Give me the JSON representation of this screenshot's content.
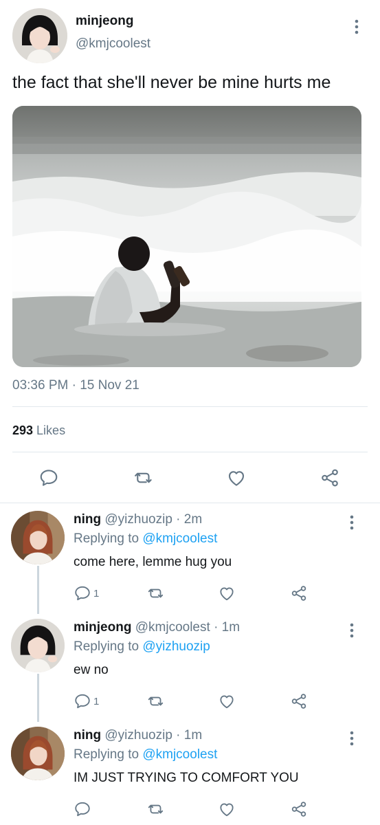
{
  "tweet": {
    "author_name": "minjeong",
    "author_handle": "@kmjcoolest",
    "text": "the fact that she'll never be mine hurts me",
    "timestamp": "03:36 PM · 15 Nov 21",
    "likes_count": "293",
    "likes_label": "Likes"
  },
  "actions": [
    "reply-icon",
    "retweet-icon",
    "like-icon",
    "share-icon"
  ],
  "colors": {
    "accent": "#1da1f2",
    "secondary": "#657786",
    "divider": "#e1e8ed"
  },
  "replies": [
    {
      "name": "ning",
      "handle": "@yizhuozip",
      "time": "· 2m",
      "replying_label": "Replying to",
      "replying_to": "@kmjcoolest",
      "text": "come here, lemme hug you",
      "reply_count": "1"
    },
    {
      "name": "minjeong",
      "handle": "@kmjcoolest",
      "time": "· 1m",
      "replying_label": "Replying to",
      "replying_to": "@yizhuozip",
      "text": "ew no",
      "reply_count": "1"
    },
    {
      "name": "ning",
      "handle": "@yizhuozip",
      "time": "· 1m",
      "replying_label": "Replying to",
      "replying_to": "@kmjcoolest",
      "text": "IM JUST TRYING TO COMFORT YOU",
      "reply_count": ""
    }
  ]
}
